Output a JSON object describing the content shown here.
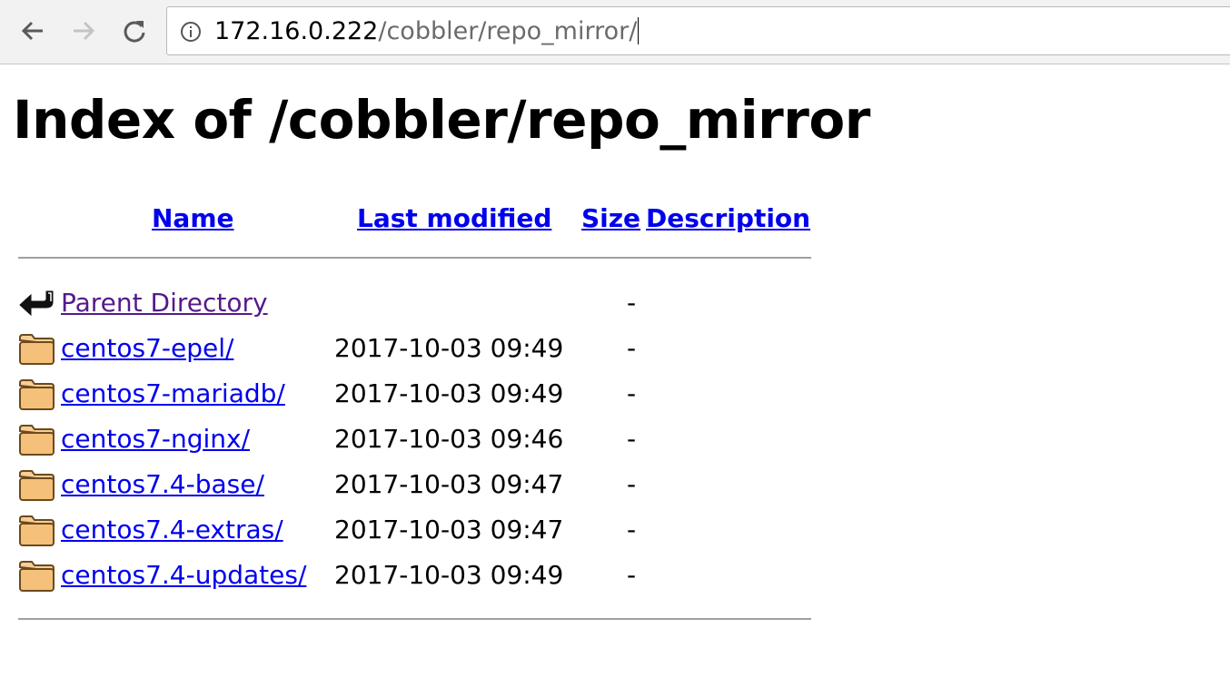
{
  "browser": {
    "back_icon": "arrow-left-icon",
    "forward_icon": "arrow-right-icon",
    "reload_icon": "reload-icon",
    "info_icon": "info-circle-icon",
    "url_host": "172.16.0.222",
    "url_path": "/cobbler/repo_mirror/"
  },
  "page": {
    "title": "Index of /cobbler/repo_mirror"
  },
  "table": {
    "columns": {
      "name": "Name",
      "last_modified": "Last modified",
      "size": "Size",
      "description": "Description"
    },
    "rows": [
      {
        "icon": "back-arrow-icon",
        "name": "Parent Directory",
        "date": "",
        "size": "-"
      },
      {
        "icon": "folder-icon",
        "name": "centos7-epel/",
        "date": "2017-10-03 09:49",
        "size": "-"
      },
      {
        "icon": "folder-icon",
        "name": "centos7-mariadb/",
        "date": "2017-10-03 09:49",
        "size": "-"
      },
      {
        "icon": "folder-icon",
        "name": "centos7-nginx/",
        "date": "2017-10-03 09:46",
        "size": "-"
      },
      {
        "icon": "folder-icon",
        "name": "centos7.4-base/",
        "date": "2017-10-03 09:47",
        "size": "-"
      },
      {
        "icon": "folder-icon",
        "name": "centos7.4-extras/",
        "date": "2017-10-03 09:47",
        "size": "-"
      },
      {
        "icon": "folder-icon",
        "name": "centos7.4-updates/",
        "date": "2017-10-03 09:49",
        "size": "-"
      }
    ]
  },
  "colors": {
    "link": "#0000ee",
    "visited_link": "#551a8b",
    "folder_fill": "#f5c07a",
    "folder_stroke": "#6b4a1e"
  }
}
